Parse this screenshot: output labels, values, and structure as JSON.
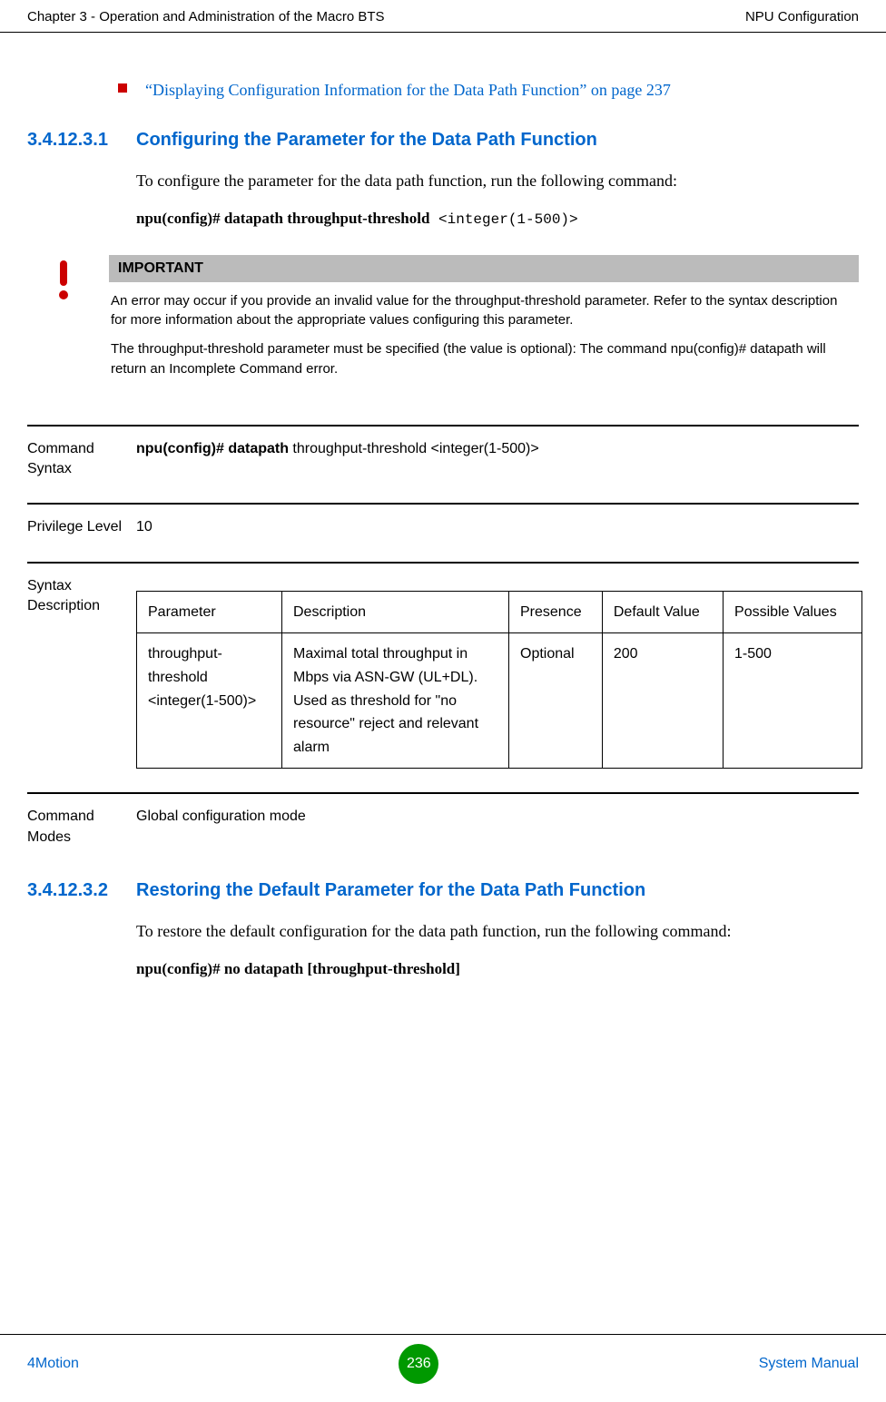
{
  "header": {
    "left": "Chapter 3 - Operation and Administration of the Macro BTS",
    "right": "NPU Configuration"
  },
  "bullet_link": "“Displaying Configuration Information for the Data Path Function” on page 237",
  "section1": {
    "num": "3.4.12.3.1",
    "title": "Configuring the Parameter for the Data Path Function",
    "intro": "To configure the parameter for the data path function, run the following command:",
    "cmd_bold": "npu(config)# datapath throughput-threshold",
    "cmd_arg": " <integer(1-500)>"
  },
  "important": {
    "label": "IMPORTANT",
    "p1": "An error may occur if you provide an invalid value for the throughput-threshold parameter. Refer to the syntax description for more information about the appropriate values configuring this parameter.",
    "p2": "The throughput-threshold parameter must be specified (the value is optional): The command npu(config)# datapath will return an Incomplete Command error."
  },
  "defs": {
    "cmd_syntax_label": "Command Syntax",
    "cmd_syntax_bold": "npu(config)# datapath",
    "cmd_syntax_rest": " throughput-threshold <integer(1-500)>",
    "priv_label": "Privilege Level",
    "priv_value": "10",
    "syntax_desc_label": "Syntax Description",
    "cmd_modes_label": "Command Modes",
    "cmd_modes_value": "Global configuration mode"
  },
  "table": {
    "headers": {
      "param": "Parameter",
      "desc": "Description",
      "presence": "Presence",
      "default": "Default Value",
      "possible": "Possible Values"
    },
    "row": {
      "param": "throughput-threshold <integer(1-500)>",
      "desc": "Maximal total throughput in Mbps via ASN-GW (UL+DL). Used as threshold for \"no resource\" reject and relevant alarm",
      "presence": "Optional",
      "default": "200",
      "possible": "1-500"
    }
  },
  "section2": {
    "num": "3.4.12.3.2",
    "title": "Restoring the Default Parameter for the Data Path Function",
    "intro": "To restore the default configuration for the data path function, run the following command:",
    "cmd_bold": "npu(config)# no datapath [throughput-threshold]"
  },
  "footer": {
    "left": "4Motion",
    "page": "236",
    "right": "System Manual"
  }
}
